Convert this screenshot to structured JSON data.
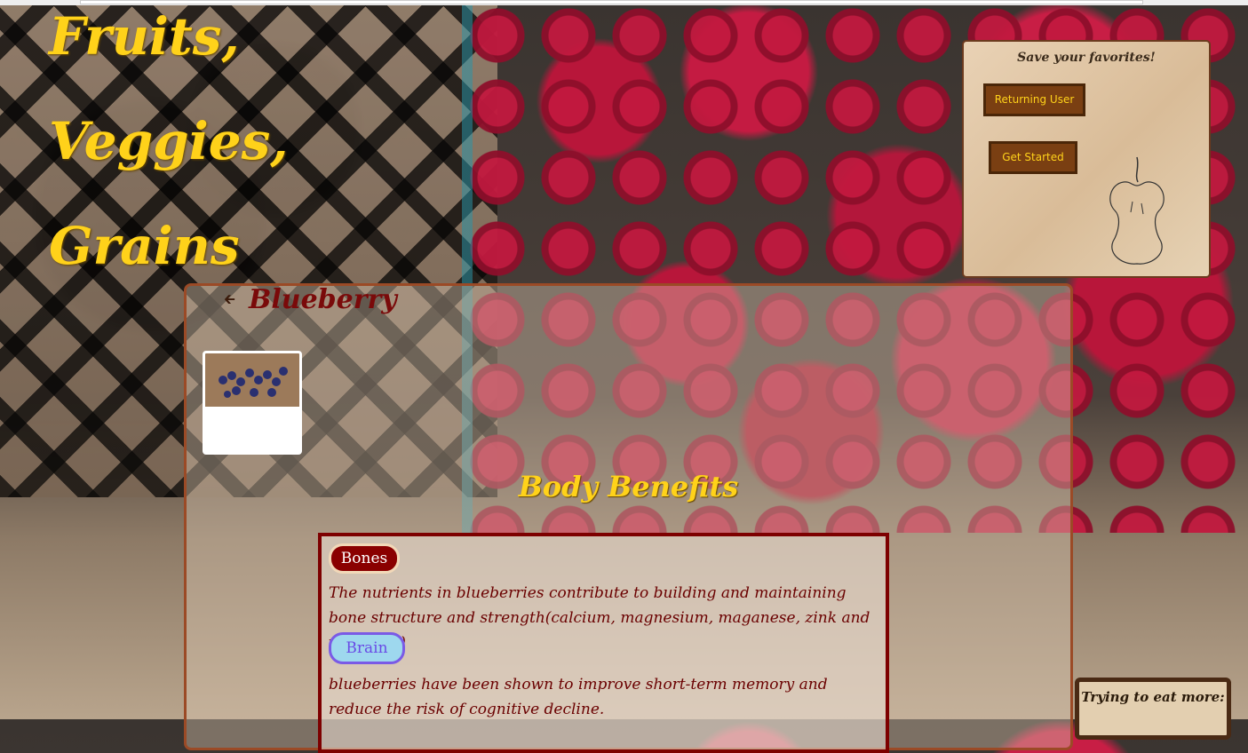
{
  "site": {
    "title_line1": "Fruits,",
    "title_line2": "Veggies,",
    "title_line3": "Grains"
  },
  "login_panel": {
    "title": "Save your favorites!",
    "returning_user_label": "Returning User",
    "get_started_label": "Get Started",
    "image_icon": "apple-core-sketch"
  },
  "item": {
    "back_icon": "arrow-left-icon",
    "name": "Blueberry",
    "image_alt": "blueberries"
  },
  "benefits": {
    "heading": "Body Benefits",
    "entries": [
      {
        "tag": "Bones",
        "text": "The nutrients in blueberries contribute to building and maintaining bone structure and strength(calcium, magnesium, maganese, zink and vitamin k)"
      },
      {
        "tag": "Brain",
        "text": "blueberries have been shown to improve short-term memory and reduce the risk of cognitive decline."
      }
    ]
  },
  "side_card": {
    "title": "Trying to eat more:"
  },
  "colors": {
    "title_yellow": "#ffd21a",
    "dark_red": "#7d0000",
    "button_brown": "#7a3f12",
    "brain_blue": "#9ed8ee",
    "brain_purple": "#7a5ae6"
  }
}
